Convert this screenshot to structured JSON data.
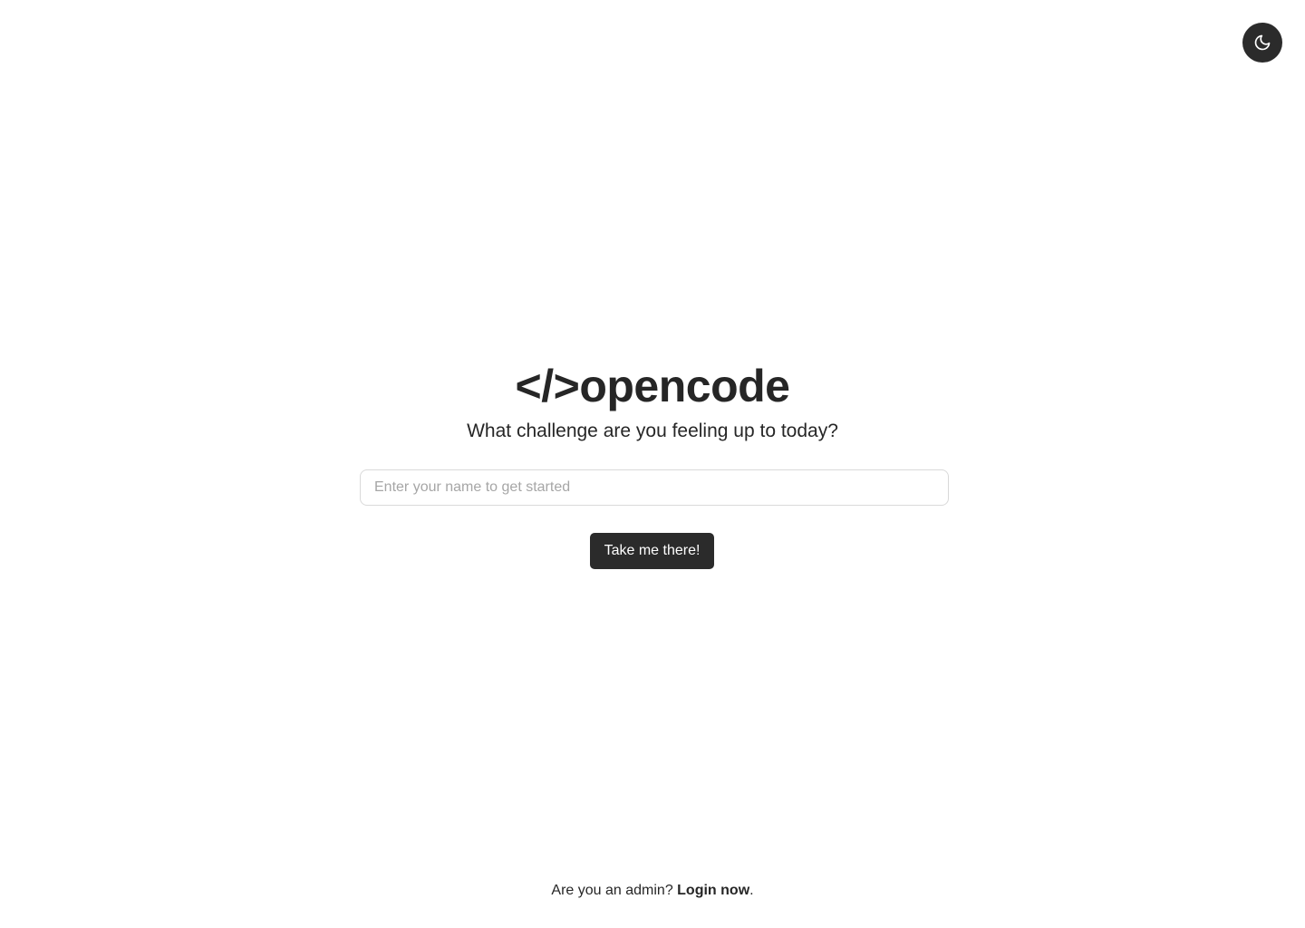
{
  "header": {
    "theme_toggle_icon": "moon-icon"
  },
  "hero": {
    "brand": "</>opencode",
    "tagline": "What challenge are you feeling up to today?"
  },
  "form": {
    "name_value": "",
    "name_placeholder": "Enter your name to get started",
    "submit_label": "Take me there!"
  },
  "footer": {
    "prompt": "Are you an admin?",
    "login_link": "Login now",
    "suffix": "."
  },
  "colors": {
    "background": "#ffffff",
    "text": "#262626",
    "button": "#2b2b2b",
    "button_text": "#ffffff",
    "input_border": "#d9d9d9",
    "placeholder": "#a6a6a6"
  }
}
